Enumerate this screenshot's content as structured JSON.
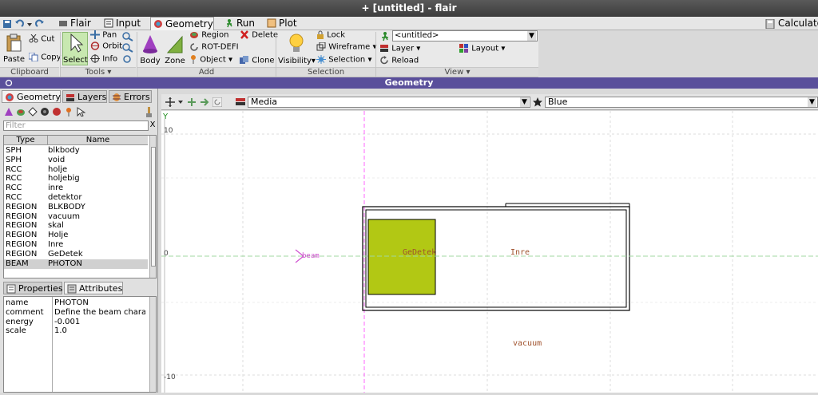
{
  "window": {
    "title": "+ [untitled] - flair"
  },
  "tabs": [
    {
      "label": "Flair"
    },
    {
      "label": "Input"
    },
    {
      "label": "Geometry"
    },
    {
      "label": "Run"
    },
    {
      "label": "Plot"
    }
  ],
  "calculator_label": "Calculato",
  "ribbon": {
    "clipboard": {
      "label": "Clipboard",
      "paste": "Paste",
      "cut": "Cut",
      "copy": "Copy"
    },
    "tools": {
      "label": "Tools",
      "select": "Select",
      "pan": "Pan",
      "orbit": "Orbit",
      "info": "Info"
    },
    "add": {
      "label": "Add",
      "body": "Body",
      "zone": "Zone",
      "region": "Region",
      "rotdefi": "ROT-DEFI",
      "object": "Object",
      "delete": "Delete",
      "clone": "Clone"
    },
    "selection": {
      "label": "Selection",
      "visibility": "Visibility",
      "lock": "Lock",
      "wireframe": "Wireframe",
      "selection": "Selection"
    },
    "view": {
      "label": "View",
      "project": "<untitled>",
      "layer": "Layer",
      "layout": "Layout",
      "reload": "Reload"
    }
  },
  "geometry_header": "Geometry",
  "left_tabs": [
    {
      "label": "Geometry"
    },
    {
      "label": "Layers"
    },
    {
      "label": "Errors"
    }
  ],
  "filter_placeholder": "Filter",
  "filter_clear": "X",
  "tree": {
    "headers": {
      "type": "Type",
      "name": "Name"
    },
    "rows": [
      {
        "type": "SPH",
        "name": "blkbody"
      },
      {
        "type": "SPH",
        "name": "void"
      },
      {
        "type": "RCC",
        "name": "holje"
      },
      {
        "type": "RCC",
        "name": "holjebig"
      },
      {
        "type": "RCC",
        "name": "inre"
      },
      {
        "type": "RCC",
        "name": "detektor"
      },
      {
        "type": "REGION",
        "name": "BLKBODY"
      },
      {
        "type": "REGION",
        "name": "vacuum"
      },
      {
        "type": "REGION",
        "name": "skal"
      },
      {
        "type": "REGION",
        "name": "Holje"
      },
      {
        "type": "REGION",
        "name": "Inre"
      },
      {
        "type": "REGION",
        "name": "GeDetek"
      },
      {
        "type": "BEAM",
        "name": "PHOTON"
      }
    ],
    "selected_index": 12
  },
  "prop_tabs": [
    {
      "label": "Properties"
    },
    {
      "label": "Attributes"
    }
  ],
  "properties": [
    {
      "key": "name",
      "value": "PHOTON"
    },
    {
      "key": "comment",
      "value": "Define the beam charac"
    },
    {
      "key": "energy",
      "value": "-0.001"
    },
    {
      "key": "scale",
      "value": "1.0"
    }
  ],
  "canvas_bar": {
    "layer_combo": "Media",
    "color_combo": "Blue"
  },
  "viewport": {
    "y_axis_label": "Y",
    "ticks": [
      "10",
      "0",
      "-10"
    ],
    "labels": {
      "beam": "beam",
      "gedetek": "GeDetek",
      "inre": "Inre",
      "vacuum": "vacuum"
    },
    "colors": {
      "detector_fill": "#b2c814",
      "region_label": "#a0522d",
      "beam_line": "#a0d8a0",
      "axis_line": "#ff66ff",
      "bg": "#ffffff"
    }
  },
  "colors": {
    "header_purple": "#5a4f9b"
  }
}
